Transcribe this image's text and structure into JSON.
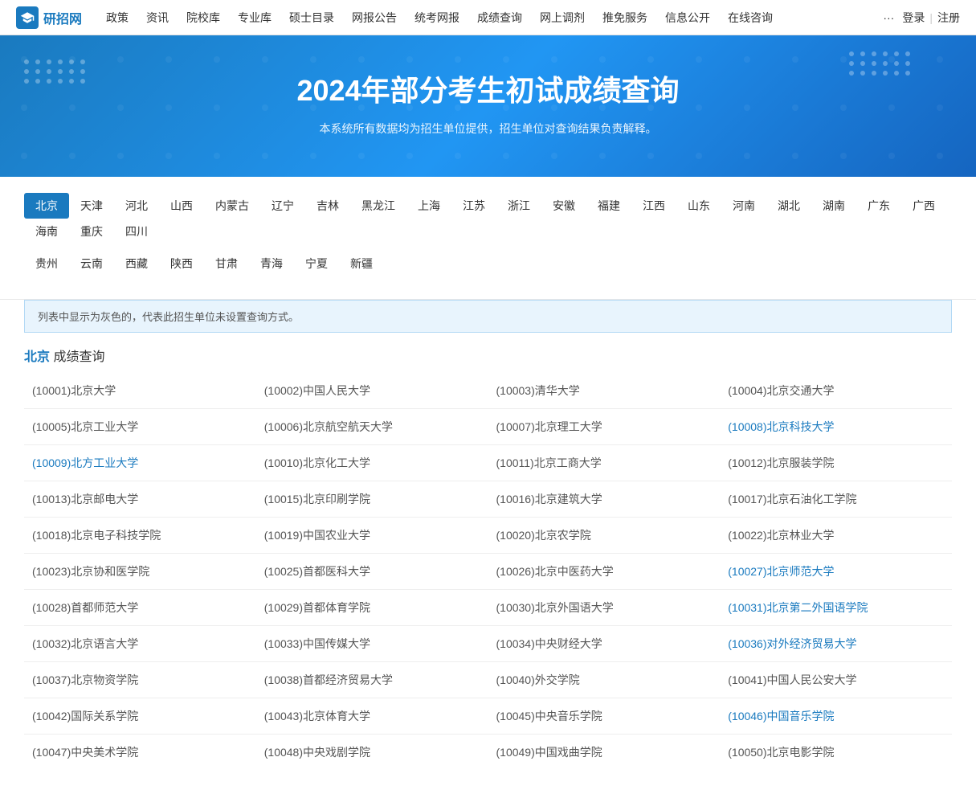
{
  "nav": {
    "logo_text": "研招网",
    "items": [
      {
        "label": "政策",
        "id": "policy"
      },
      {
        "label": "资讯",
        "id": "news"
      },
      {
        "label": "院校库",
        "id": "school-db"
      },
      {
        "label": "专业库",
        "id": "major-db"
      },
      {
        "label": "硕士目录",
        "id": "master-catalog"
      },
      {
        "label": "网报公告",
        "id": "online-notice"
      },
      {
        "label": "统考网报",
        "id": "unified-exam"
      },
      {
        "label": "成绩查询",
        "id": "score-query"
      },
      {
        "label": "网上调剂",
        "id": "online-transfer"
      },
      {
        "label": "推免服务",
        "id": "exemption"
      },
      {
        "label": "信息公开",
        "id": "info-open"
      },
      {
        "label": "在线咨询",
        "id": "online-consult"
      }
    ],
    "more": "···",
    "login": "登录",
    "separator": "|",
    "register": "注册"
  },
  "hero": {
    "title": "2024年部分考生初试成绩查询",
    "subtitle": "本系统所有数据均为招生单位提供，招生单位对查询结果负责解释。"
  },
  "regions": {
    "row1": [
      {
        "label": "北京",
        "active": true
      },
      {
        "label": "天津"
      },
      {
        "label": "河北"
      },
      {
        "label": "山西"
      },
      {
        "label": "内蒙古"
      },
      {
        "label": "辽宁"
      },
      {
        "label": "吉林"
      },
      {
        "label": "黑龙江"
      },
      {
        "label": "上海"
      },
      {
        "label": "江苏"
      },
      {
        "label": "浙江"
      },
      {
        "label": "安徽"
      },
      {
        "label": "福建"
      },
      {
        "label": "江西"
      },
      {
        "label": "山东"
      },
      {
        "label": "河南"
      },
      {
        "label": "湖北"
      },
      {
        "label": "湖南"
      },
      {
        "label": "广东"
      },
      {
        "label": "广西"
      },
      {
        "label": "海南"
      },
      {
        "label": "重庆"
      },
      {
        "label": "四川"
      }
    ],
    "row2": [
      {
        "label": "贵州"
      },
      {
        "label": "云南"
      },
      {
        "label": "西藏"
      },
      {
        "label": "陕西"
      },
      {
        "label": "甘肃"
      },
      {
        "label": "青海"
      },
      {
        "label": "宁夏"
      },
      {
        "label": "新疆"
      }
    ]
  },
  "info_box": "列表中显示为灰色的，代表此招生单位未设置查询方式。",
  "section": {
    "region": "北京",
    "title_suffix": "成绩查询"
  },
  "universities": [
    [
      {
        "code": "10001",
        "name": "北京大学",
        "link": false
      },
      {
        "code": "10002",
        "name": "中国人民大学",
        "link": false
      },
      {
        "code": "10003",
        "name": "清华大学",
        "link": false
      },
      {
        "code": "10004",
        "name": "北京交通大学",
        "link": false
      }
    ],
    [
      {
        "code": "10005",
        "name": "北京工业大学",
        "link": false
      },
      {
        "code": "10006",
        "name": "北京航空航天大学",
        "link": false
      },
      {
        "code": "10007",
        "name": "北京理工大学",
        "link": false
      },
      {
        "code": "10008",
        "name": "北京科技大学",
        "link": true
      }
    ],
    [
      {
        "code": "10009",
        "name": "北方工业大学",
        "link": true
      },
      {
        "code": "10010",
        "name": "北京化工大学",
        "link": false
      },
      {
        "code": "10011",
        "name": "北京工商大学",
        "link": false
      },
      {
        "code": "10012",
        "name": "北京服装学院",
        "link": false
      }
    ],
    [
      {
        "code": "10013",
        "name": "北京邮电大学",
        "link": false
      },
      {
        "code": "10015",
        "name": "北京印刷学院",
        "link": false
      },
      {
        "code": "10016",
        "name": "北京建筑大学",
        "link": false
      },
      {
        "code": "10017",
        "name": "北京石油化工学院",
        "link": false
      }
    ],
    [
      {
        "code": "10018",
        "name": "北京电子科技学院",
        "link": false
      },
      {
        "code": "10019",
        "name": "中国农业大学",
        "link": false
      },
      {
        "code": "10020",
        "name": "北京农学院",
        "link": false
      },
      {
        "code": "10022",
        "name": "北京林业大学",
        "link": false
      }
    ],
    [
      {
        "code": "10023",
        "name": "北京协和医学院",
        "link": false
      },
      {
        "code": "10025",
        "name": "首都医科大学",
        "link": false
      },
      {
        "code": "10026",
        "name": "北京中医药大学",
        "link": false
      },
      {
        "code": "10027",
        "name": "北京师范大学",
        "link": true
      }
    ],
    [
      {
        "code": "10028",
        "name": "首都师范大学",
        "link": false
      },
      {
        "code": "10029",
        "name": "首都体育学院",
        "link": false
      },
      {
        "code": "10030",
        "name": "北京外国语大学",
        "link": false
      },
      {
        "code": "10031",
        "name": "北京第二外国语学院",
        "link": true
      }
    ],
    [
      {
        "code": "10032",
        "name": "北京语言大学",
        "link": false
      },
      {
        "code": "10033",
        "name": "中国传媒大学",
        "link": false
      },
      {
        "code": "10034",
        "name": "中央财经大学",
        "link": false
      },
      {
        "code": "10036",
        "name": "对外经济贸易大学",
        "link": true
      }
    ],
    [
      {
        "code": "10037",
        "name": "北京物资学院",
        "link": false
      },
      {
        "code": "10038",
        "name": "首都经济贸易大学",
        "link": false
      },
      {
        "code": "10040",
        "name": "外交学院",
        "link": false
      },
      {
        "code": "10041",
        "name": "中国人民公安大学",
        "link": false
      }
    ],
    [
      {
        "code": "10042",
        "name": "国际关系学院",
        "link": false
      },
      {
        "code": "10043",
        "name": "北京体育大学",
        "link": false
      },
      {
        "code": "10045",
        "name": "中央音乐学院",
        "link": false
      },
      {
        "code": "10046",
        "name": "中国音乐学院",
        "link": true
      }
    ],
    [
      {
        "code": "10047",
        "name": "中央美术学院",
        "link": false
      },
      {
        "code": "10048",
        "name": "中央戏剧学院",
        "link": false
      },
      {
        "code": "10049",
        "name": "中国戏曲学院",
        "link": false
      },
      {
        "code": "10050",
        "name": "北京电影学院",
        "link": false
      }
    ]
  ]
}
